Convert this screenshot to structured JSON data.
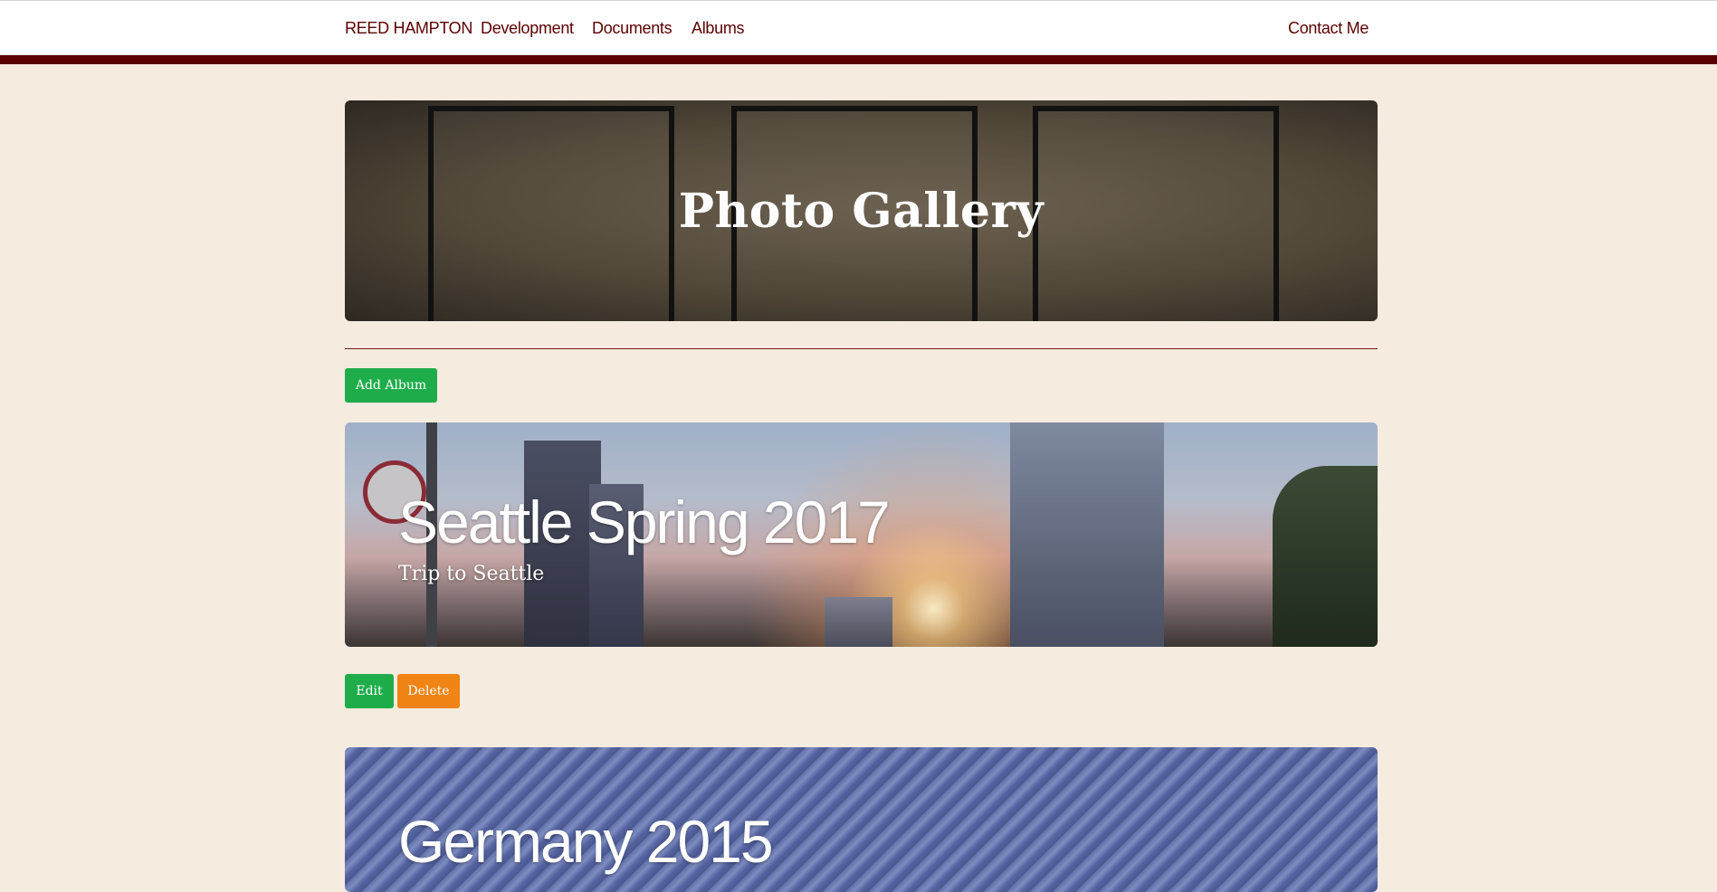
{
  "nav": {
    "brand": "REED HAMPTON",
    "development": "Development",
    "documents": "Documents",
    "albums": "Albums",
    "contact": "Contact Me"
  },
  "hero": {
    "title": "Photo Gallery"
  },
  "actions": {
    "add_album": "Add Album",
    "edit": "Edit",
    "delete": "Delete"
  },
  "albums": [
    {
      "title": "Seattle Spring 2017",
      "subtitle": "Trip to Seattle"
    },
    {
      "title": "Germany 2015"
    }
  ],
  "colors": {
    "background": "#f5ebdf",
    "brand": "#5c0000",
    "success": "#1fad4b",
    "warning": "#f08414"
  }
}
